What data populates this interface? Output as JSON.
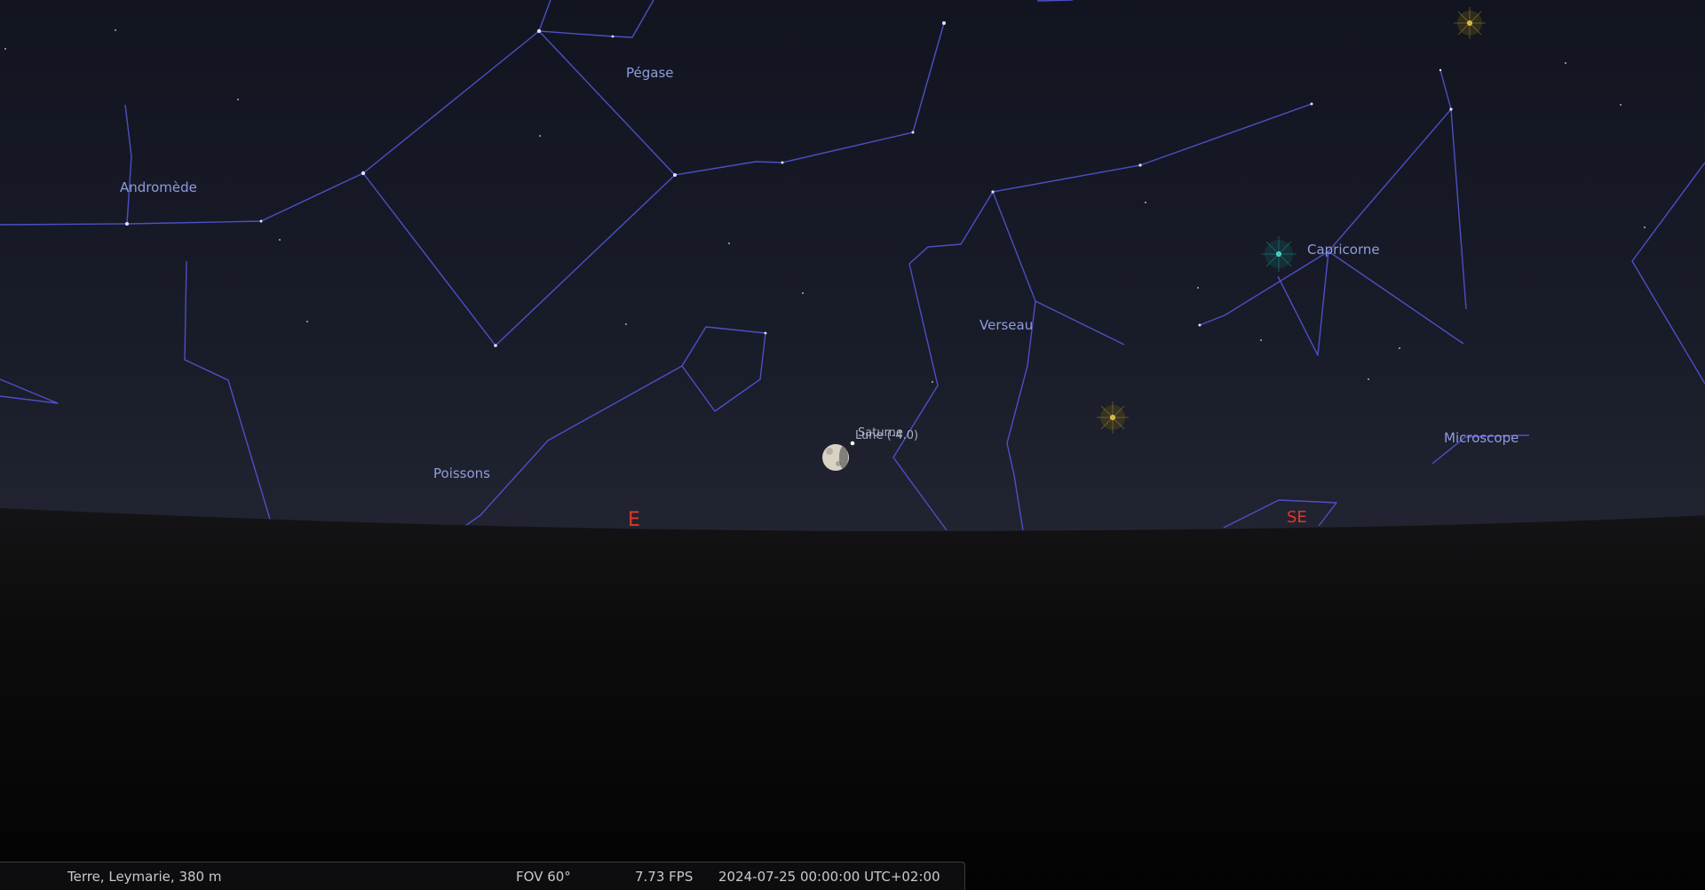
{
  "constellations": {
    "pegase": "Pégase",
    "andromede": "Andromède",
    "verseau": "Verseau",
    "capricorne": "Capricorne",
    "poissons": "Poissons",
    "microscope": "Microscope"
  },
  "cardinals": {
    "east": "E",
    "southeast": "SE"
  },
  "objects": {
    "saturn": "Saturne",
    "moon": "Lune (-4.0)"
  },
  "status": {
    "location": "Terre, Leymarie, 380 m",
    "fov": "FOV 60°",
    "fps": "7.73 FPS",
    "datetime": "2024-07-25 00:00:00 UTC+02:00"
  },
  "colors": {
    "constellation_lines": "#4d4fc4",
    "constellation_labels": "#8f9cdc",
    "cardinal": "#e0372a"
  }
}
